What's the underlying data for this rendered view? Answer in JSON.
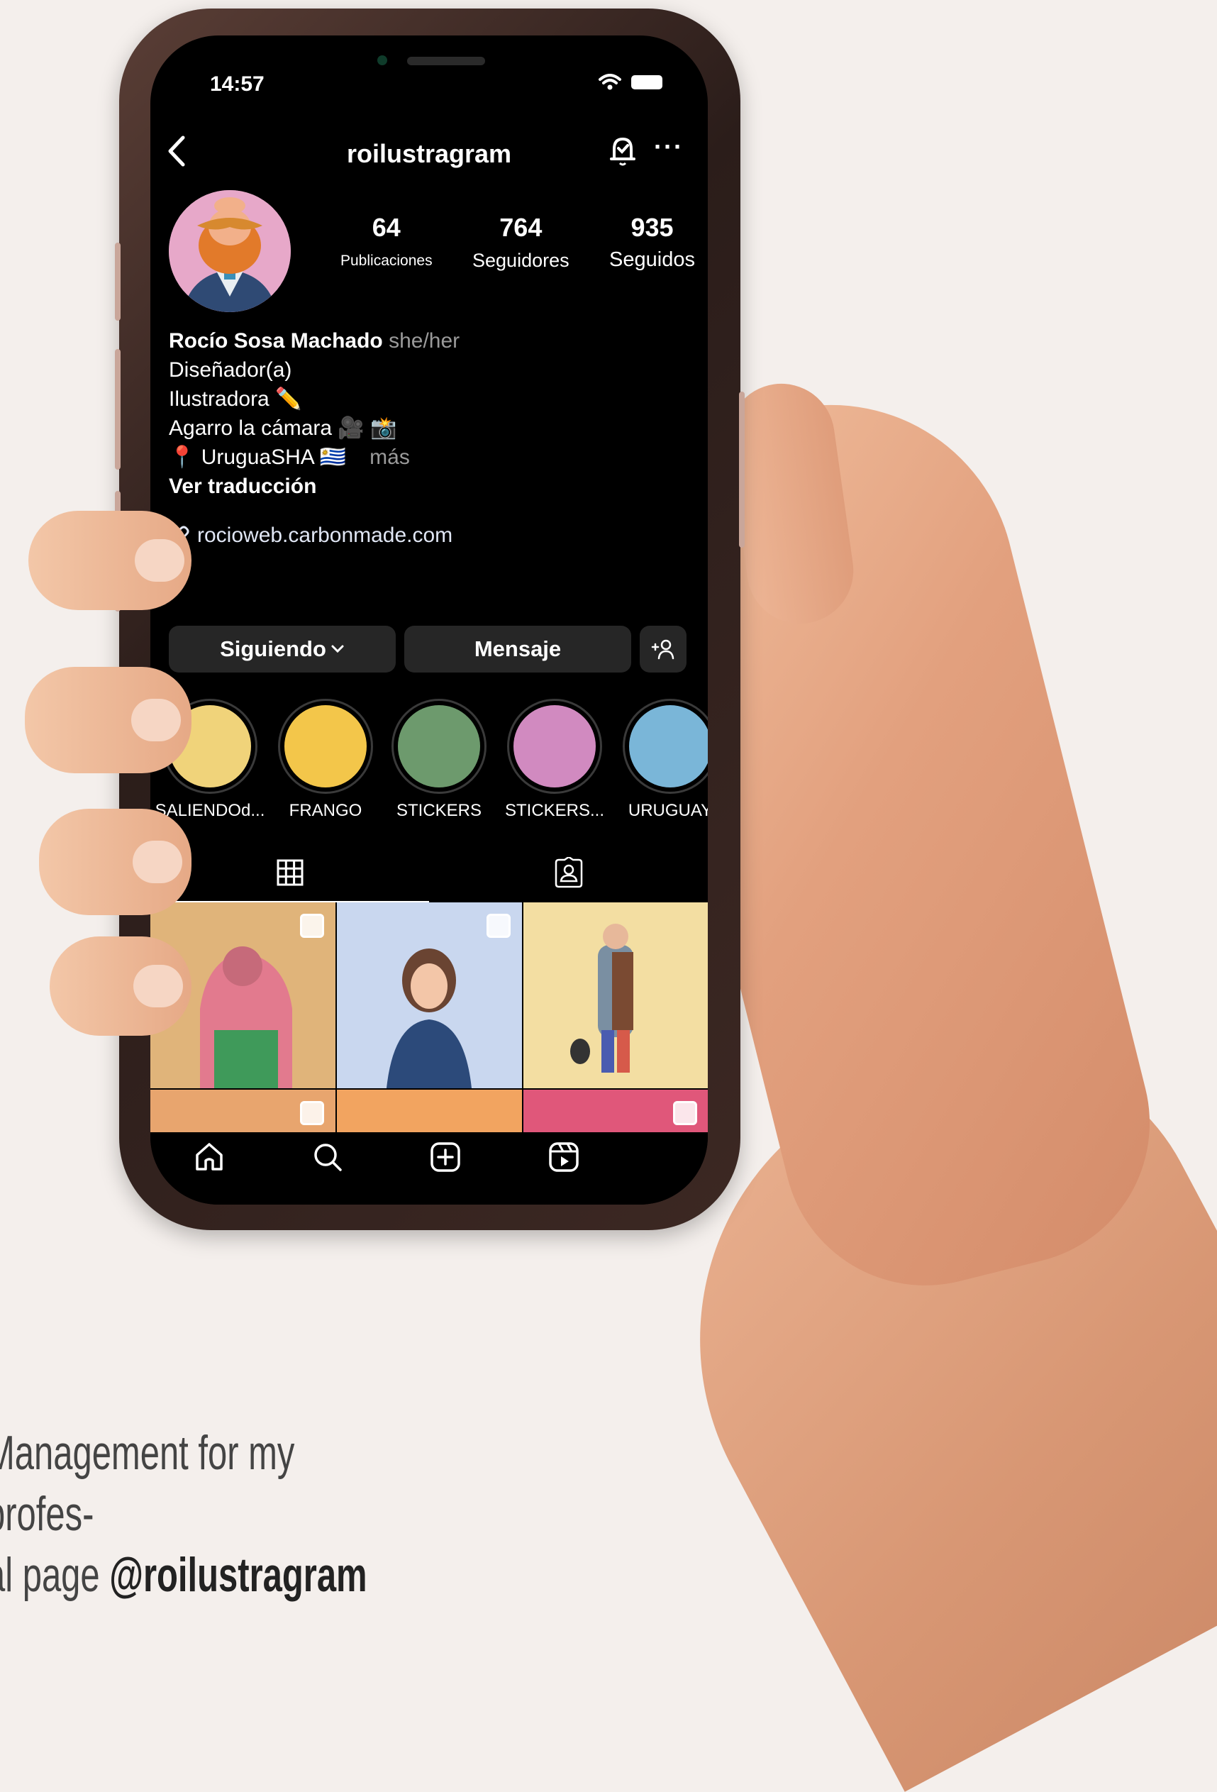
{
  "status_bar": {
    "time": "14:57"
  },
  "header": {
    "username": "roilustragram"
  },
  "stats": [
    {
      "value": "64",
      "label": "Publicaciones"
    },
    {
      "value": "764",
      "label": "Seguidores"
    },
    {
      "value": "935",
      "label": "Seguidos"
    }
  ],
  "bio": {
    "name": "Rocío Sosa Machado",
    "pronouns": "she/her",
    "category": "Diseñador(a)",
    "line1": "Ilustradora ✏️",
    "line2": "Agarro la cámara 🎥 📸",
    "line3": "📍 UruguaSHA 🇺🇾",
    "more": "más",
    "translate": "Ver traducción",
    "link": "rocioweb.carbonmade.com"
  },
  "actions": {
    "following": "Siguiendo",
    "message": "Mensaje"
  },
  "highlights": [
    {
      "label": "SALIENDOd...",
      "color": "#f0d37a"
    },
    {
      "label": "FRANGO",
      "color": "#f3c64a"
    },
    {
      "label": "STICKERS",
      "color": "#6d9a6d"
    },
    {
      "label": "STICKERS...",
      "color": "#d18ac0"
    },
    {
      "label": "URUGUAY",
      "color": "#7ab6d8"
    }
  ],
  "posts": [
    {
      "color": "#e0b47a"
    },
    {
      "color": "#c9d7ef"
    },
    {
      "color": "#f3dea2"
    },
    {
      "color": "#e8a56e"
    },
    {
      "color": "#f2a460"
    },
    {
      "color": "#e0577a"
    }
  ],
  "caption": {
    "line1": "Management for my profes-",
    "line2_prefix": "al page ",
    "handle": "@roilustragram"
  }
}
